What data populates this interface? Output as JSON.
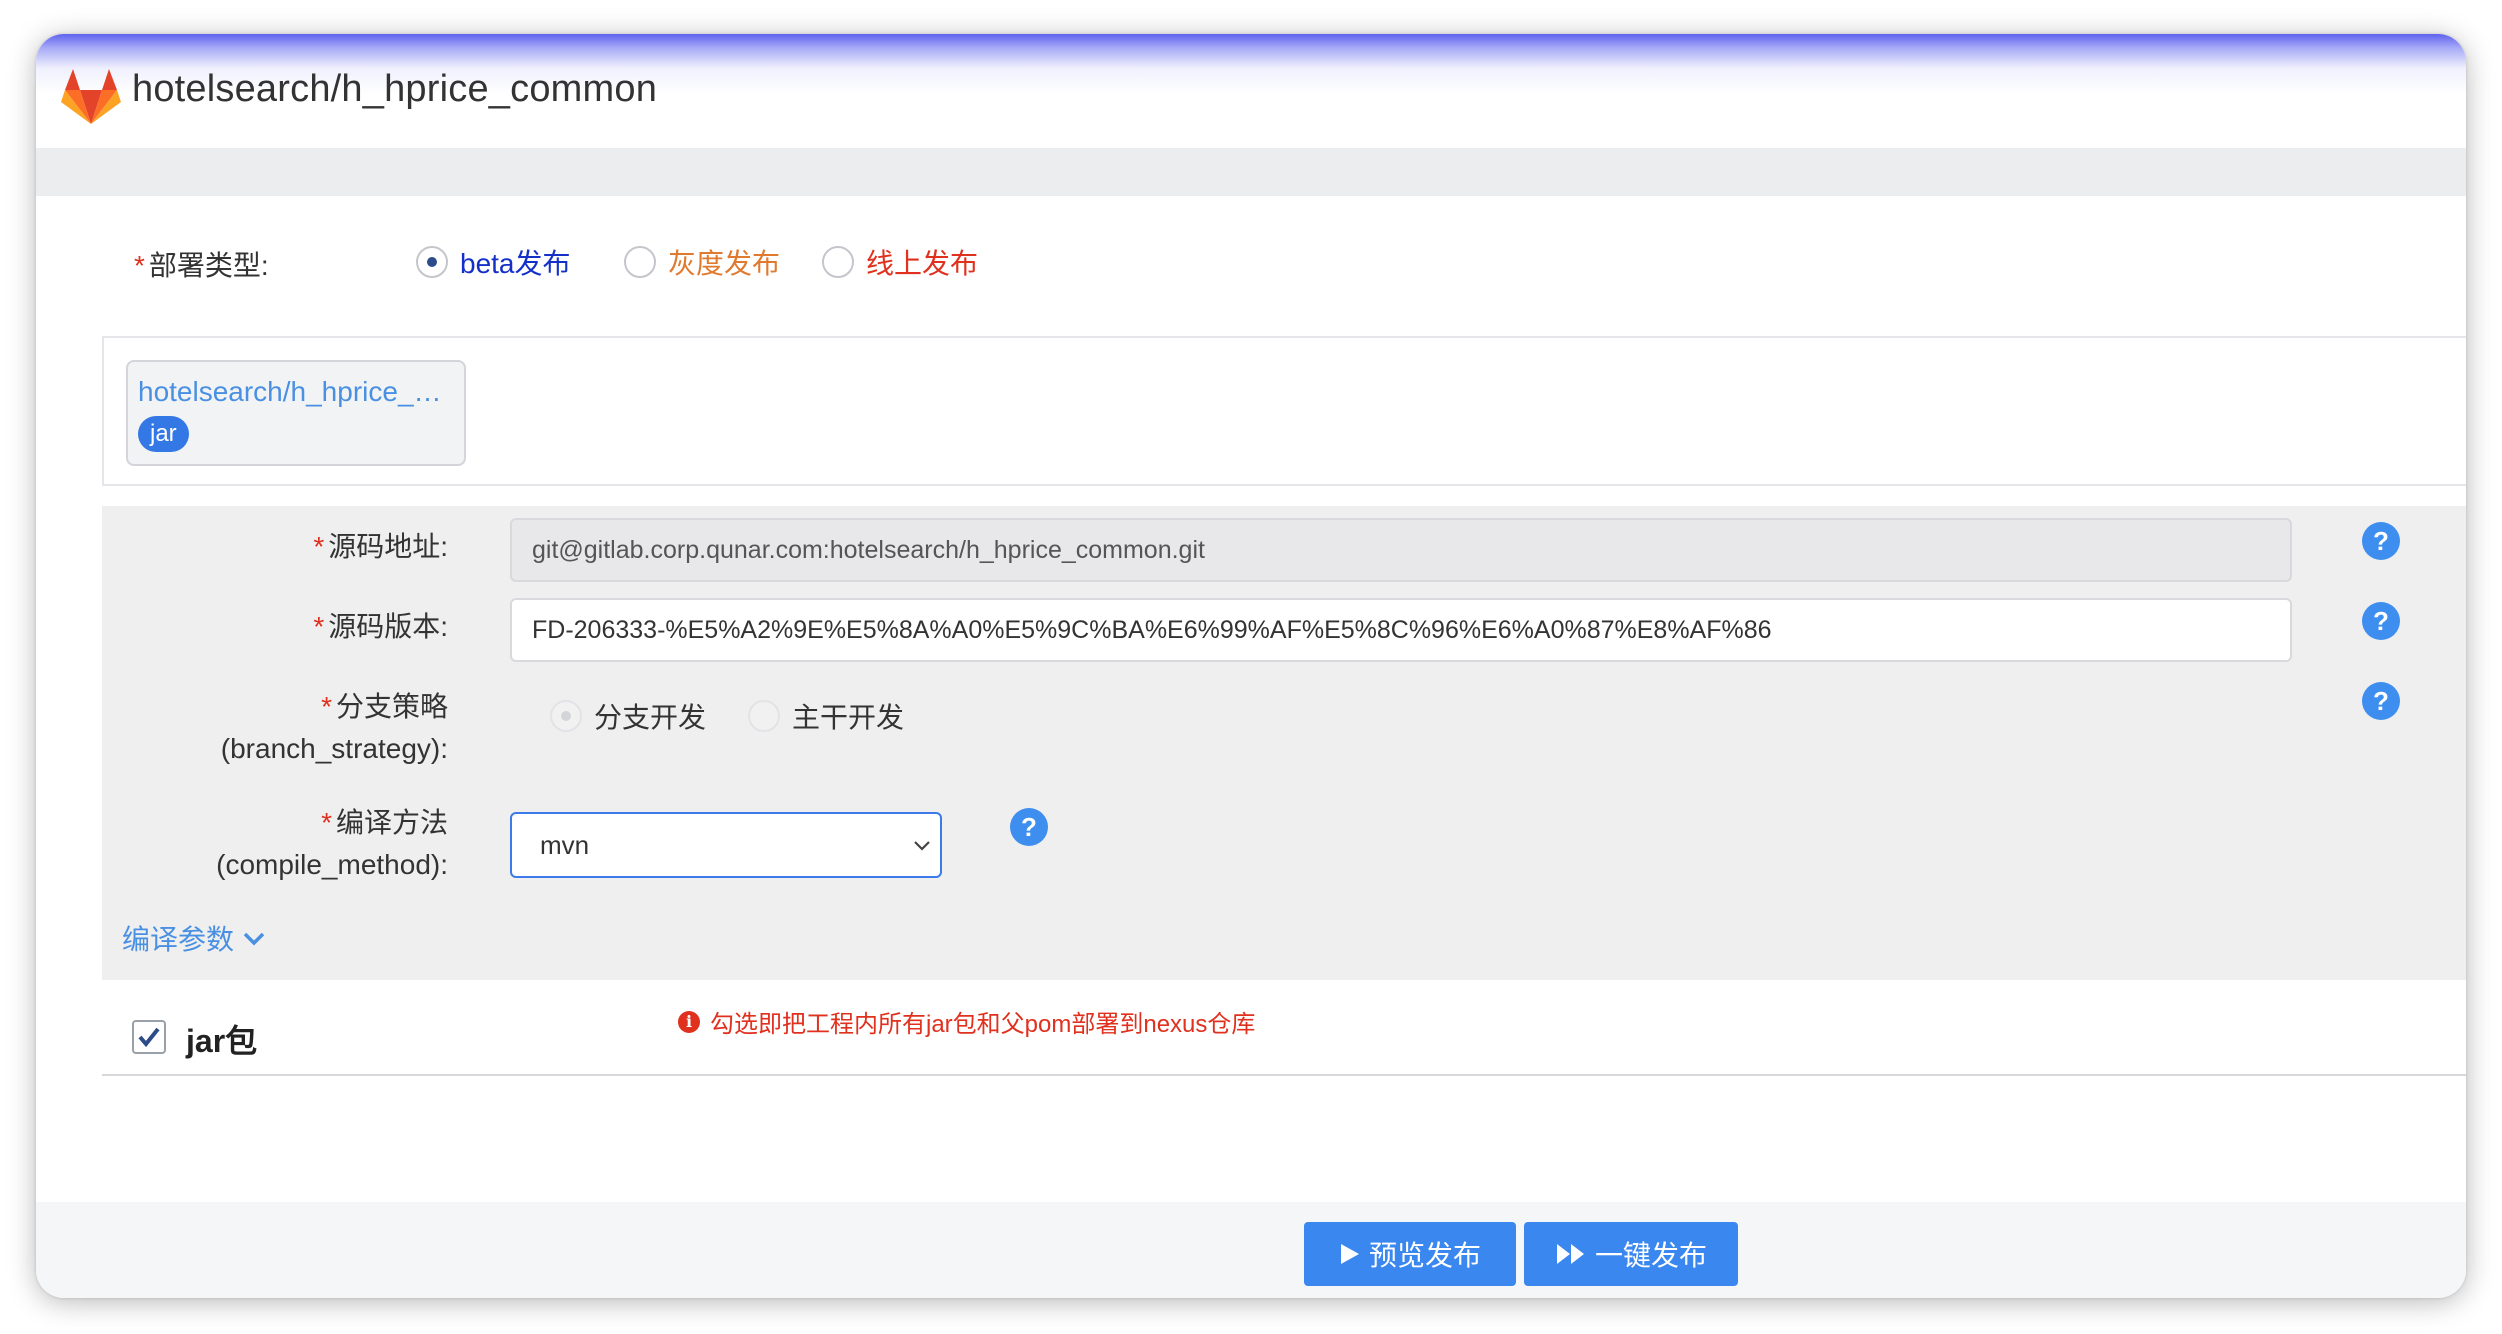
{
  "header": {
    "title": "hotelsearch/h_hprice_common"
  },
  "deploy": {
    "label": "部署类型:",
    "options": [
      {
        "label": "beta发布",
        "color": "#1530c8",
        "selected": true
      },
      {
        "label": "灰度发布",
        "color": "#e07a2f",
        "selected": false
      },
      {
        "label": "线上发布",
        "color": "#e0301e",
        "selected": false
      }
    ]
  },
  "project": {
    "name": "hotelsearch/h_hprice_common",
    "badge": "jar"
  },
  "form": {
    "source_url_label": "源码地址:",
    "source_url_value": "git@gitlab.corp.qunar.com:hotelsearch/h_hprice_common.git",
    "source_version_label": "源码版本:",
    "source_version_value": "FD-206333-%E5%A2%9E%E5%8A%A0%E5%9C%BA%E6%99%AF%E5%8C%96%E6%A0%87%E8%AF%86",
    "branch_label": "分支策略",
    "branch_sublabel": "(branch_strategy):",
    "branch_options": [
      {
        "label": "分支开发",
        "selected": true
      },
      {
        "label": "主干开发",
        "selected": false
      }
    ],
    "compile_label": "编译方法",
    "compile_sublabel": "(compile_method):",
    "compile_value": "mvn",
    "params_link": "编译参数",
    "help_symbol": "?"
  },
  "jar": {
    "label": "jar包",
    "checked": true,
    "tip_icon": "i",
    "tip": "勾选即把工程内所有jar包和父pom部署到nexus仓库"
  },
  "footer": {
    "preview_button": "预览发布",
    "deploy_button": "一键发布"
  },
  "colors": {
    "accent": "#3a87f0",
    "link": "#4a90e2",
    "required": "#e0301e"
  }
}
